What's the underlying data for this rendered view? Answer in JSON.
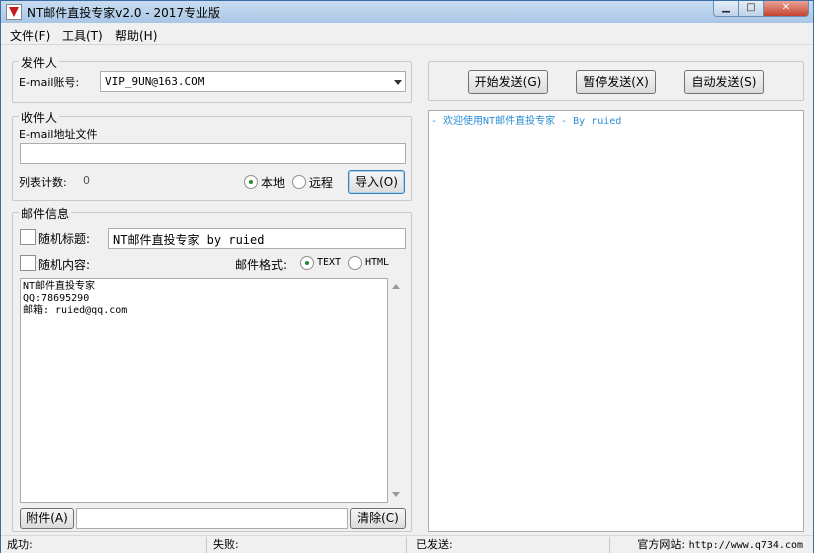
{
  "window": {
    "title": "NT邮件直投专家v2.0 - 2017专业版",
    "controls": {
      "minimize": "▁",
      "maximize": "□",
      "close": "✕"
    }
  },
  "menu": [
    "文件(F)",
    "工具(T)",
    "帮助(H)"
  ],
  "sender": {
    "legend": "发件人",
    "account_label": "E-mail账号:",
    "account_value": "VIP_9UN@163.COM"
  },
  "recipient": {
    "legend": "收件人",
    "file_label": "E-mail地址文件",
    "file_value": "",
    "count_label": "列表计数:",
    "count_value": "0",
    "source_local": "本地",
    "source_remote": "远程",
    "source_selected": "local",
    "import_button": "导入(O)"
  },
  "mail": {
    "legend": "邮件信息",
    "random_subject_label": "随机标题:",
    "random_subject_checked": false,
    "subject_value": "NT邮件直投专家 by ruied",
    "random_content_label": "随机内容:",
    "random_content_checked": false,
    "format_label": "邮件格式:",
    "format_text": "TEXT",
    "format_html": "HTML",
    "format_selected": "TEXT",
    "body_lines": [
      "NT邮件直投专家",
      "QQ:78695290",
      "邮箱: ruied@qq.com"
    ],
    "attach_button": "附件(A)",
    "attach_value": "",
    "clear_button": "清除(C)"
  },
  "actions": {
    "start": "开始发送(G)",
    "pause": "暂停发送(X)",
    "auto": "自动发送(S)"
  },
  "log": {
    "lines": [
      "- 欢迎使用NT邮件直投专家 - By ruied"
    ]
  },
  "status": {
    "success": "成功:",
    "fail": "失败:",
    "sent": "已发送:",
    "website_label": "官方网站:",
    "website_url": "http://www.q734.com"
  },
  "colors": {
    "log_text": "#2a8dd4",
    "accent": "#3c7fb1"
  }
}
